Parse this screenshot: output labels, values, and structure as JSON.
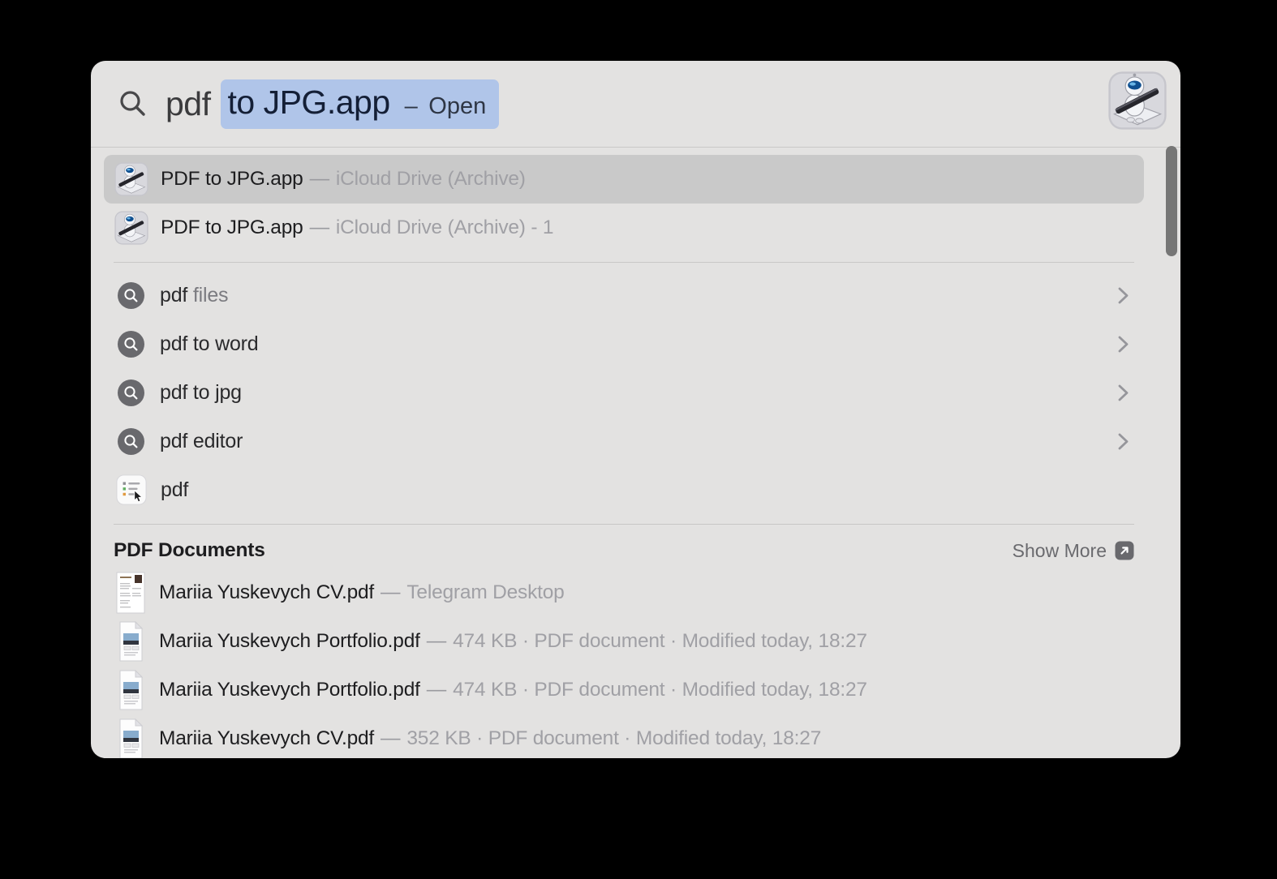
{
  "colors": {
    "panel_bg": "#e3e2e1",
    "selection_blue": "#b0c5e9",
    "selected_row_bg": "#c9c9c9",
    "primary_text": "#1d1d1f",
    "secondary_text": "#9a9a9f",
    "divider": "#c8c7c6",
    "suggestion_icon_bg": "#69696d",
    "scrollbar": "#767676"
  },
  "search": {
    "typed": "pdf",
    "selected_completion": "to JPG.app",
    "hint_dash": "–",
    "hint_label": "Open"
  },
  "top_results": {
    "items": [
      {
        "name": "PDF to JPG.app",
        "separator": "—",
        "location": "iCloud Drive (Archive)",
        "selected": true
      },
      {
        "name": "PDF to JPG.app",
        "separator": "—",
        "location": "iCloud Drive (Archive) - 1",
        "selected": false
      }
    ]
  },
  "suggestions": {
    "items": [
      {
        "typed": "pdf",
        "completion": " files"
      },
      {
        "typed": "pdf to word",
        "completion": ""
      },
      {
        "typed": "pdf to jpg",
        "completion": ""
      },
      {
        "typed": "pdf editor",
        "completion": ""
      }
    ],
    "recent": {
      "label": "pdf"
    }
  },
  "documents": {
    "header": "PDF Documents",
    "show_more_label": "Show More",
    "items": [
      {
        "name": "Mariia Yuskevych CV.pdf",
        "separator": "—",
        "meta": "Telegram Desktop"
      },
      {
        "name": "Mariia Yuskevych Portfolio.pdf",
        "separator": "—",
        "meta": "474 KB · PDF document · Modified today, 18:27"
      },
      {
        "name": "Mariia Yuskevych Portfolio.pdf",
        "separator": "—",
        "meta": "474 KB · PDF document · Modified today, 18:27"
      },
      {
        "name": "Mariia Yuskevych CV.pdf",
        "separator": "—",
        "meta": "352 KB · PDF document · Modified today, 18:27"
      }
    ]
  }
}
